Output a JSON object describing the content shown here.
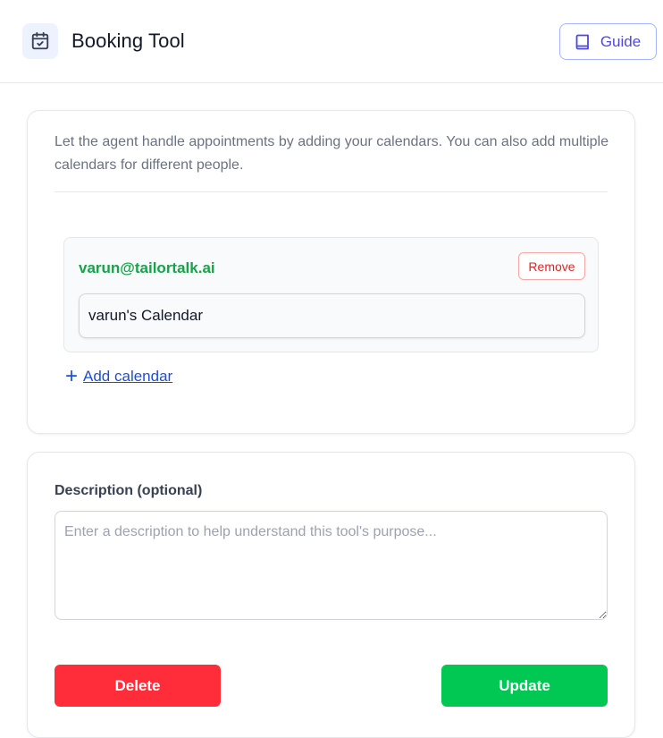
{
  "header": {
    "title": "Booking Tool",
    "guide_label": "Guide",
    "icon": "calendar-check-icon",
    "guide_icon": "book-icon"
  },
  "calendars_section": {
    "intro_text": "Let the agent handle appointments by adding your calendars. You can also add multiple calendars for different people.",
    "calendars": [
      {
        "email": "varun@tailortalk.ai",
        "remove_label": "Remove",
        "calendar_name": "varun's Calendar"
      }
    ],
    "add_calendar_label": "Add calendar"
  },
  "description_section": {
    "label": "Description (optional)",
    "placeholder": "Enter a description to help understand this tool's purpose...",
    "value": ""
  },
  "actions": {
    "delete_label": "Delete",
    "update_label": "Update"
  },
  "colors": {
    "accent": "#4f46e5",
    "email_green": "#16a34a",
    "delete_red": "#ff2d3a",
    "update_green": "#00c853",
    "link_blue": "#1d4ed8"
  }
}
